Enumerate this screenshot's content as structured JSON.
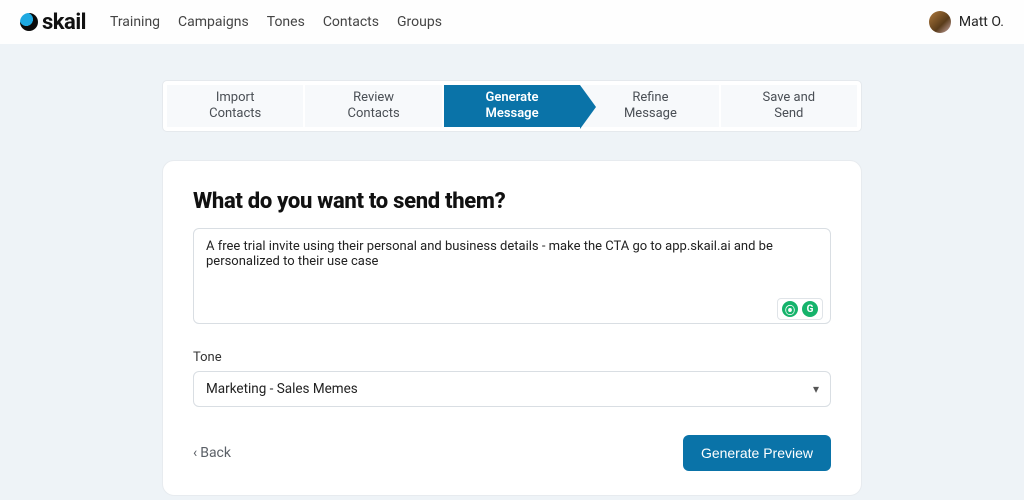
{
  "brand": {
    "name": "skail"
  },
  "nav": {
    "items": [
      "Training",
      "Campaigns",
      "Tones",
      "Contacts",
      "Groups"
    ]
  },
  "user": {
    "display_name": "Matt O."
  },
  "stepper": {
    "steps": [
      {
        "label": "Import\nContacts"
      },
      {
        "label": "Review\nContacts"
      },
      {
        "label": "Generate\nMessage"
      },
      {
        "label": "Refine\nMessage"
      },
      {
        "label": "Save and\nSend"
      }
    ],
    "active_index": 2
  },
  "main": {
    "heading": "What do you want to send them?",
    "message_value": "A free trial invite using their personal and business details - make the CTA go to app.skail.ai and be personalized to their use case",
    "tone_label": "Tone",
    "tone_value": "Marketing - Sales Memes",
    "back_label": "Back",
    "submit_label": "Generate Preview"
  },
  "colors": {
    "accent": "#0a73a8"
  }
}
